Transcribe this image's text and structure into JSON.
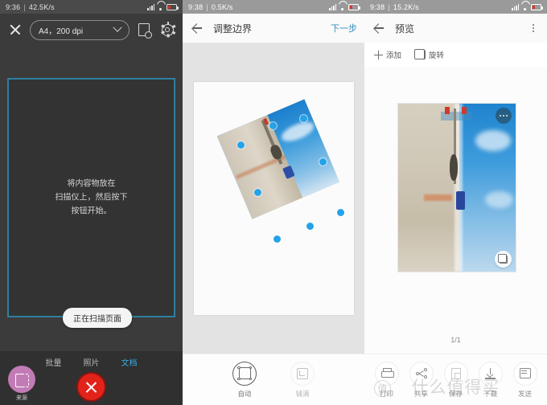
{
  "panel_scan": {
    "status_bar": {
      "time": "9:36",
      "network_speed": "42.5K/s"
    },
    "close_label": "close-icon",
    "dpi_value": "A4，200 dpi",
    "preview_icon": "document-search-icon",
    "settings_icon": "gear-icon",
    "hint_line1": "将内容物放在",
    "hint_line2": "扫描仪上，然后按下",
    "hint_line3": "按钮开始。",
    "toast": "正在扫描页面",
    "tabs": [
      {
        "label": "批量",
        "active": false
      },
      {
        "label": "照片",
        "active": false
      },
      {
        "label": "文档",
        "active": true
      }
    ],
    "source_label": "来源",
    "cancel_label": "cancel-scan",
    "accent_blue": "#3aa9e0",
    "cancel_red": "#e2231a",
    "source_purple": "#c27bb4"
  },
  "panel_crop": {
    "status_bar": {
      "time": "9:38",
      "network_speed": "0.5K/s"
    },
    "title": "调整边界",
    "next_label": "下一步",
    "modes": [
      {
        "label": "自动",
        "active": true
      },
      {
        "label": "铺满",
        "active": false
      }
    ],
    "handle_color": "#25a3e8",
    "next_color": "#2f8dbc"
  },
  "panel_preview": {
    "status_bar": {
      "time": "9:38",
      "network_speed": "15.2K/s"
    },
    "title": "预览",
    "menu_icon": "kebab-menu-icon",
    "actions": [
      {
        "label": "添加",
        "icon": "plus-icon"
      },
      {
        "label": "旋转",
        "icon": "rotate-icon"
      }
    ],
    "page_count": "1/1",
    "bottom_actions": [
      {
        "label": "打印",
        "icon": "printer-icon"
      },
      {
        "label": "共享",
        "icon": "share-icon"
      },
      {
        "label": "保存",
        "icon": "document-icon"
      },
      {
        "label": "下载",
        "icon": "download-icon"
      },
      {
        "label": "发送",
        "icon": "mail-icon"
      }
    ],
    "watermark": "什么值得买",
    "watermark_logo": "值"
  }
}
